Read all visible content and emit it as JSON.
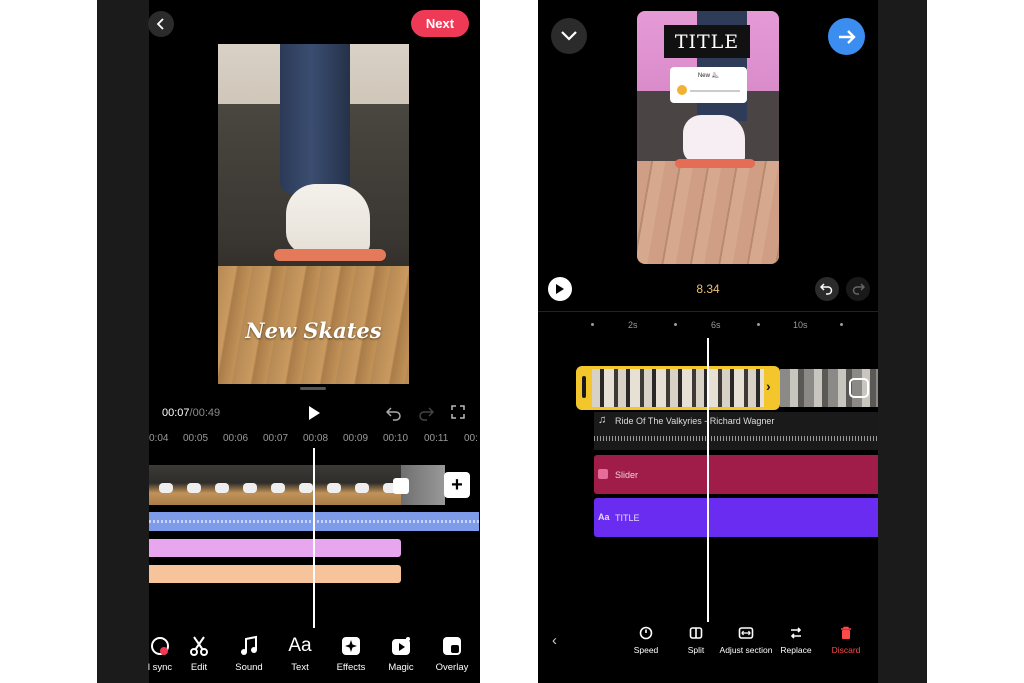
{
  "left_editor": {
    "next_label": "Next",
    "caption": "New Skates",
    "time_current": "00:07",
    "time_total": "/00:49",
    "timeline_ticks": [
      "0:04",
      "00:05",
      "00:06",
      "00:07",
      "00:08",
      "00:09",
      "00:10",
      "00:11",
      "00:"
    ],
    "add_icon": "+",
    "tools": [
      {
        "label": "l sync",
        "icon": "audio-sync-icon"
      },
      {
        "label": "Edit",
        "icon": "scissors-icon"
      },
      {
        "label": "Sound",
        "icon": "music-note-icon"
      },
      {
        "label": "Text",
        "icon": "text-aa-icon"
      },
      {
        "label": "Effects",
        "icon": "sparkle-icon"
      },
      {
        "label": "Magic",
        "icon": "magic-icon"
      },
      {
        "label": "Overlay",
        "icon": "overlay-icon"
      }
    ],
    "colors": {
      "next": "#ee3a57",
      "audio": "#7e9bea",
      "pink_track": "#e8a6ef",
      "peach_track": "#f6c39a"
    }
  },
  "right_editor": {
    "overlay_title": "TITLE",
    "slider_sticker_label": "New ⛸️",
    "time": "8.34",
    "timeline_ticks": [
      "2s",
      "6s",
      "10s"
    ],
    "tracks": {
      "music": "Ride Of The Valkyries - Richard Wagner",
      "slider": "Slider",
      "title": "TITLE",
      "title_icon_text": "Aa"
    },
    "tools": [
      {
        "label": "Speed",
        "icon": "speed-icon"
      },
      {
        "label": "Split",
        "icon": "split-icon"
      },
      {
        "label": "Adjust section",
        "icon": "adjust-icon"
      },
      {
        "label": "Replace",
        "icon": "replace-icon"
      },
      {
        "label": "Discard",
        "icon": "trash-icon"
      }
    ],
    "colors": {
      "next": "#3b8ef0",
      "clip_border": "#f3c62b",
      "slider_track": "#9f1d48",
      "title_track": "#6a2cf0",
      "discard": "#ff4a4a"
    }
  }
}
